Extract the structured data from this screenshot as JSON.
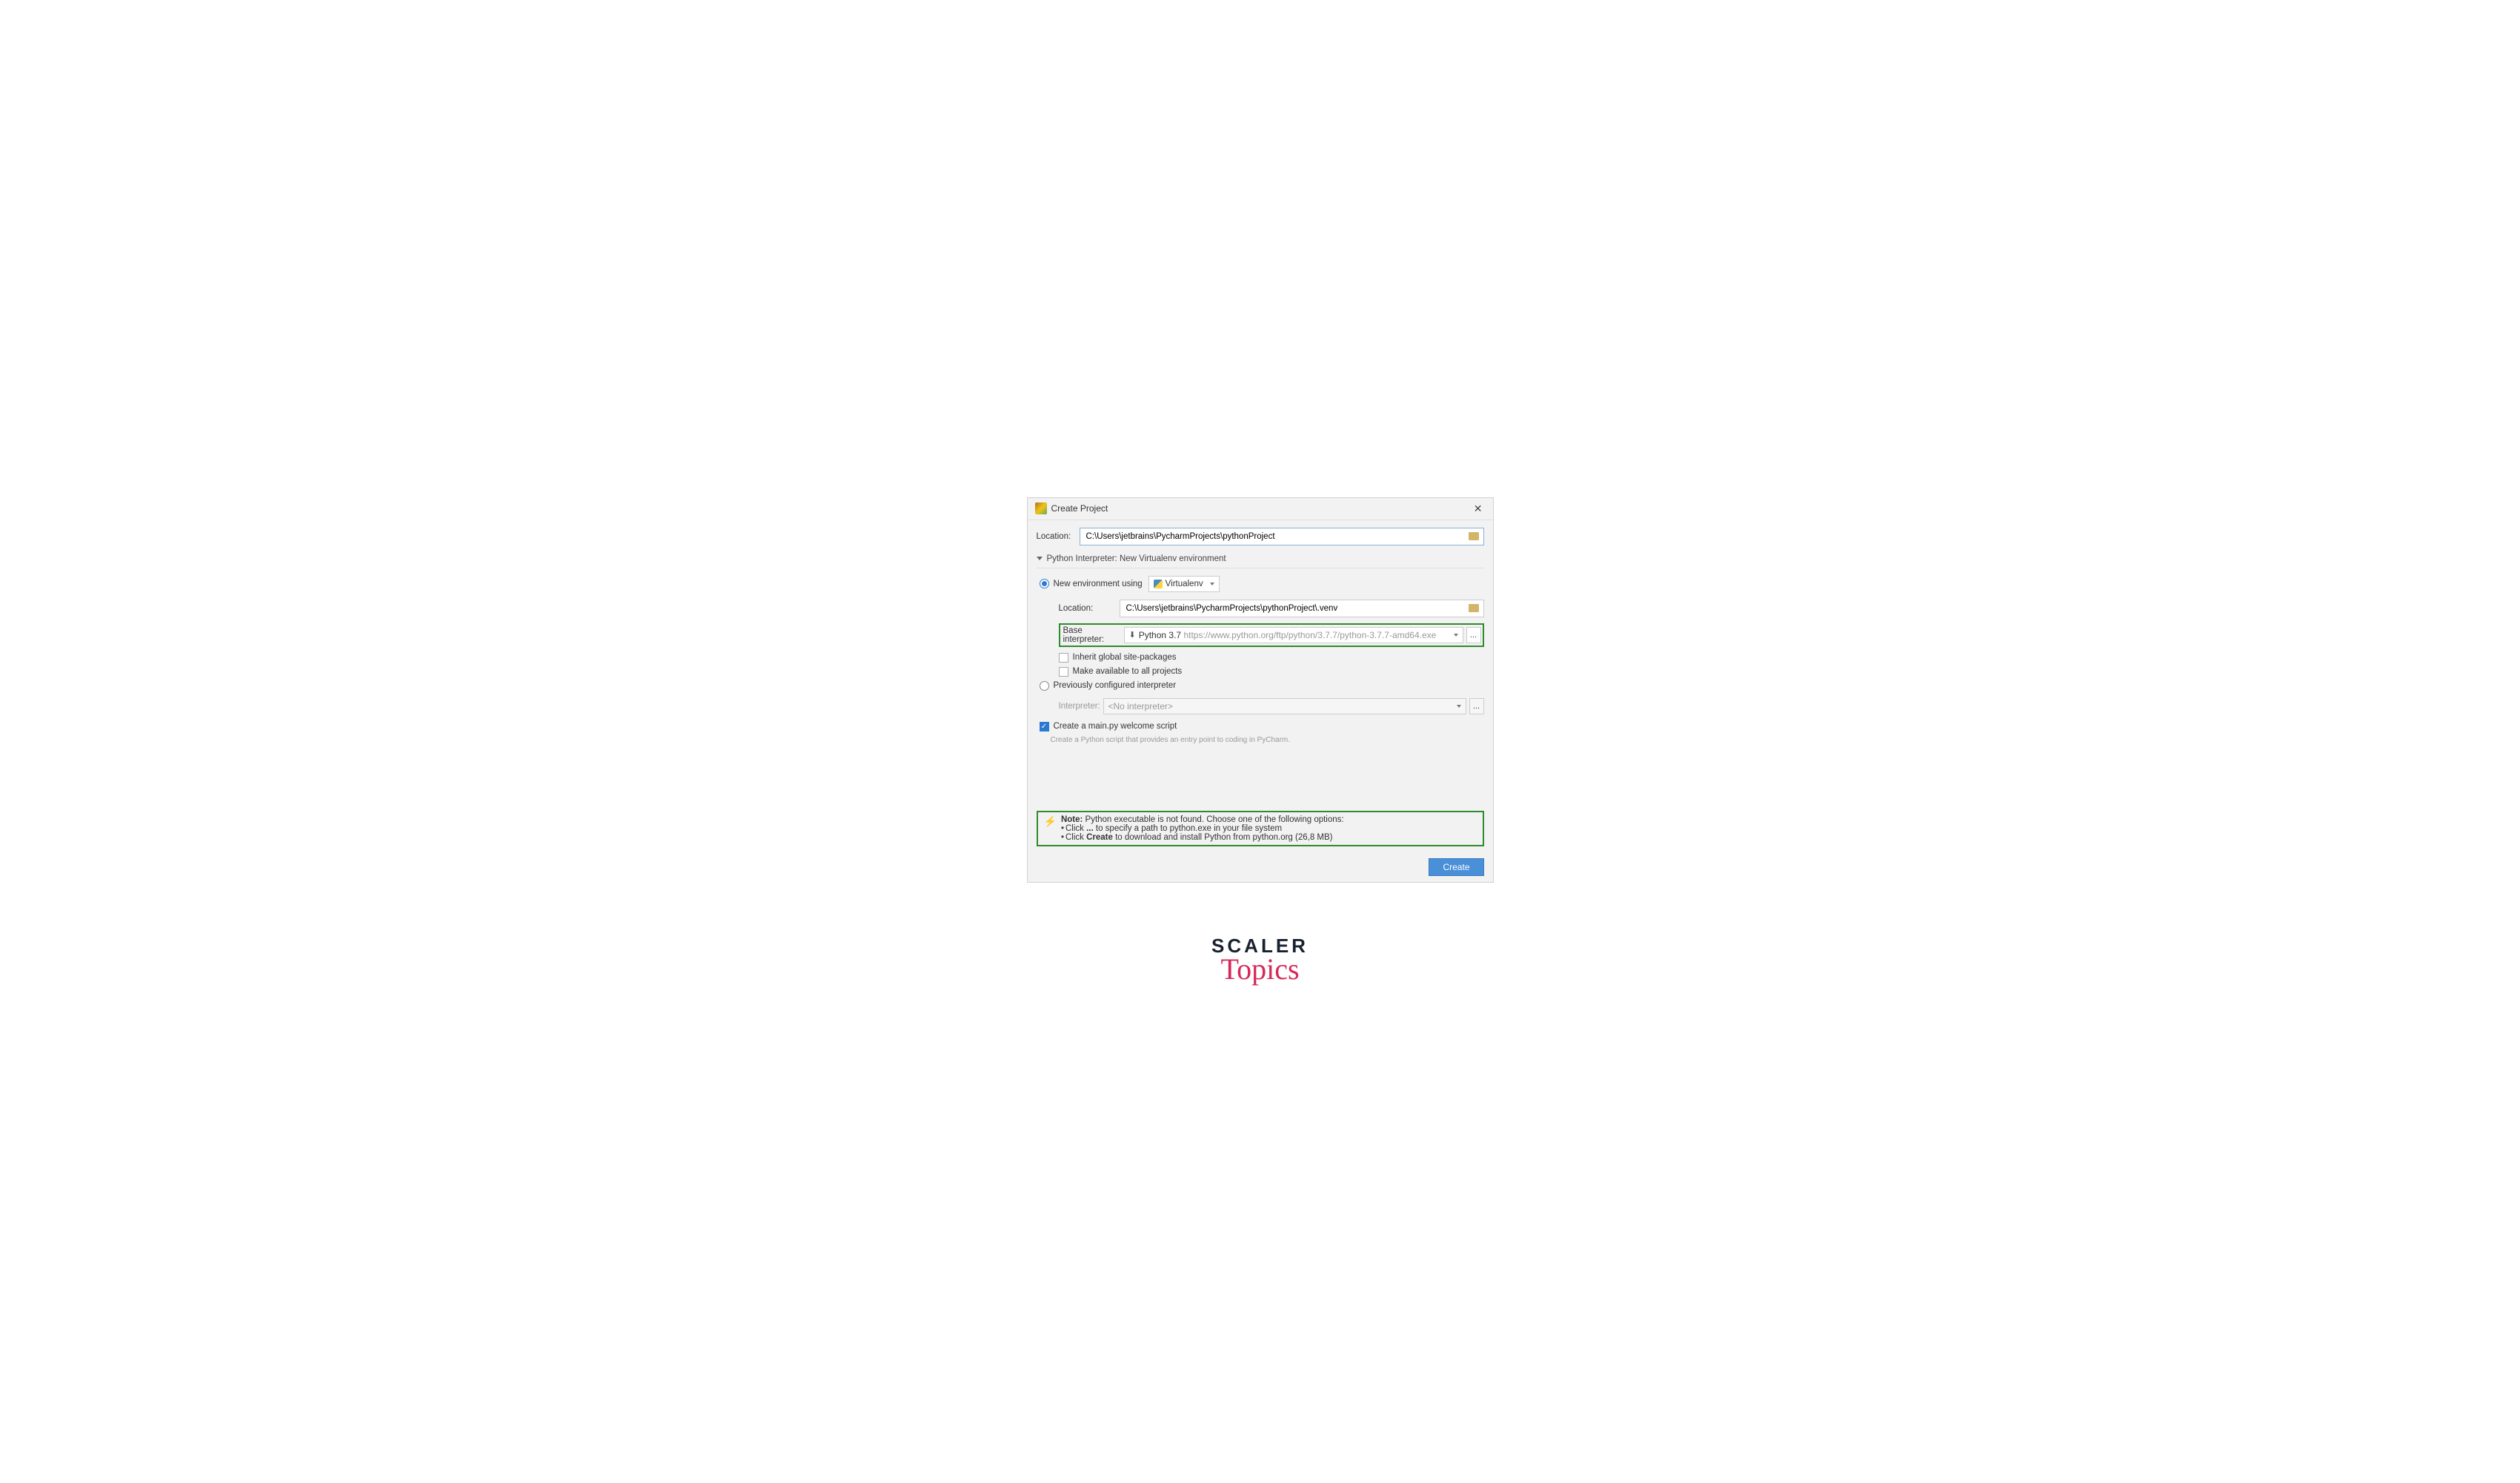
{
  "title": "Create Project",
  "location_label": "Location:",
  "location_value": "C:\\Users\\jetbrains\\PycharmProjects\\pythonProject",
  "interpreter_section": "Python Interpreter: New Virtualenv environment",
  "new_env_label": "New environment using",
  "venv_dd": "Virtualenv",
  "env_location_label": "Location:",
  "env_location_value": "C:\\Users\\jetbrains\\PycharmProjects\\pythonProject\\.venv",
  "base_label": "Base interpreter:",
  "base_version": "Python 3.7",
  "base_url": "https://www.python.org/ftp/python/3.7.7/python-3.7.7-amd64.exe",
  "inherit_label": "Inherit global site-packages",
  "avail_label": "Make available to all projects",
  "prev_label": "Previously configured interpreter",
  "interp_label": "Interpreter:",
  "interp_value": "<No interpreter>",
  "mainpy_label": "Create a main.py welcome script",
  "mainpy_hint": "Create a Python script that provides an entry point to coding in PyCharm.",
  "note_bold": "Note:",
  "note_text": " Python executable is not found. Choose one of the following options:",
  "note_line1a": "Click ",
  "note_line1b": "...",
  "note_line1c": " to specify a path to python.exe in your file system",
  "note_line2a": "Click ",
  "note_line2b": "Create",
  "note_line2c": " to download and install Python from python.org (26,8 MB)",
  "create_btn": "Create",
  "logo_top": "SCALER",
  "logo_bottom": "Topics"
}
